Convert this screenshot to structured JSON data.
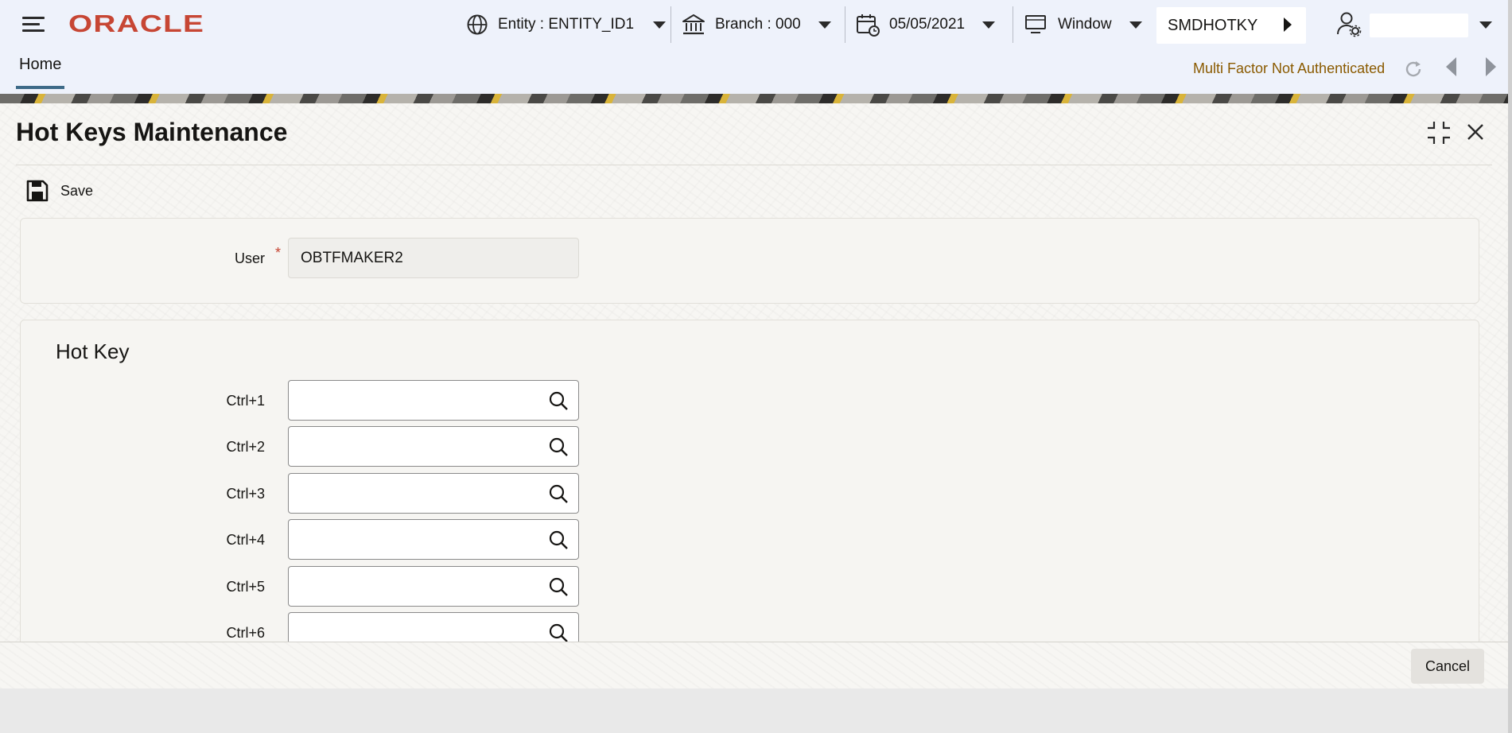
{
  "header": {
    "logo_text": "ORACLE",
    "brand_color": "#c74634",
    "entity_label": "Entity : ENTITY_ID1",
    "branch_label": "Branch : 000",
    "date_label": "05/05/2021",
    "window_label": "Window",
    "function_id": "SMDHOTKY",
    "user_name": ""
  },
  "tabs": [
    {
      "label": "Home",
      "active": true
    }
  ],
  "status": {
    "mfa_text": "Multi Factor Not Authenticated",
    "mfa_color": "#8a5a00"
  },
  "screen": {
    "title": "Hot Keys Maintenance",
    "toolbar": {
      "save_label": "Save"
    },
    "user_field": {
      "label": "User",
      "required_marker": "*",
      "value": "OBTFMAKER2"
    },
    "hotkey_section": {
      "title": "Hot Key",
      "rows": [
        {
          "label": "Ctrl+1",
          "value": ""
        },
        {
          "label": "Ctrl+2",
          "value": ""
        },
        {
          "label": "Ctrl+3",
          "value": ""
        },
        {
          "label": "Ctrl+4",
          "value": ""
        },
        {
          "label": "Ctrl+5",
          "value": ""
        },
        {
          "label": "Ctrl+6",
          "value": ""
        }
      ]
    },
    "footer": {
      "cancel_label": "Cancel"
    }
  },
  "icons": {
    "menu": "hamburger-icon",
    "entity": "globe-icon",
    "branch": "bank-icon",
    "date": "calendar-icon",
    "window": "monitor-icon",
    "user": "user-settings-icon",
    "refresh": "refresh-icon",
    "save": "floppy-disk-icon",
    "lookup": "search-icon"
  }
}
